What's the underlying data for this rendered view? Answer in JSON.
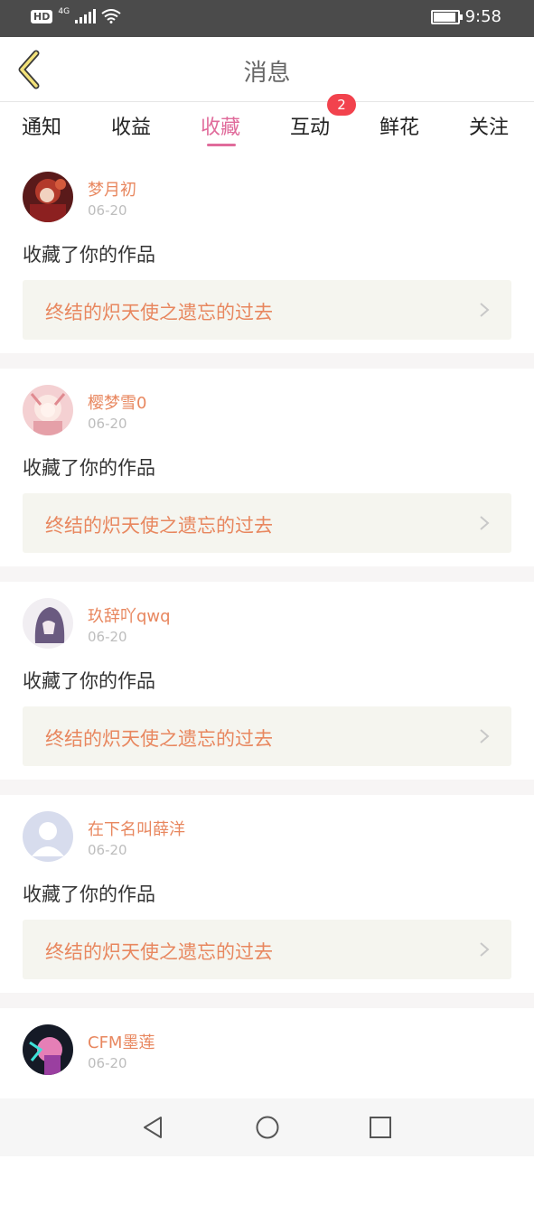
{
  "status_bar": {
    "hd": "HD",
    "network": "4G",
    "time": "9:58",
    "icons": [
      "signal-icon",
      "wifi-icon",
      "battery-icon"
    ]
  },
  "header": {
    "title": "消息",
    "back_icon": "chevron-left-icon"
  },
  "tabs": {
    "items": [
      {
        "label": "通知"
      },
      {
        "label": "收益"
      },
      {
        "label": "收藏",
        "active": true
      },
      {
        "label": "互动",
        "badge": "2"
      },
      {
        "label": "鲜花"
      },
      {
        "label": "关注"
      }
    ]
  },
  "messages": [
    {
      "user": "梦月初",
      "date": "06-20",
      "action": "收藏了你的作品",
      "work": "终结的炽天使之遗忘的过去"
    },
    {
      "user": "樱梦雪0",
      "date": "06-20",
      "action": "收藏了你的作品",
      "work": "终结的炽天使之遗忘的过去"
    },
    {
      "user": "玖辞吖qwq",
      "date": "06-20",
      "action": "收藏了你的作品",
      "work": "终结的炽天使之遗忘的过去"
    },
    {
      "user": "在下名叫薛洋",
      "date": "06-20",
      "action": "收藏了你的作品",
      "work": "终结的炽天使之遗忘的过去"
    },
    {
      "user": "CFM墨莲",
      "date": "06-20"
    }
  ],
  "colors": {
    "accent": "#e06b9b",
    "username": "#e8875f",
    "badge": "#f2424d",
    "status_bar": "#4b4b4b"
  },
  "navbar": {
    "icons": [
      "back-triangle-icon",
      "home-circle-icon",
      "recents-square-icon"
    ]
  }
}
